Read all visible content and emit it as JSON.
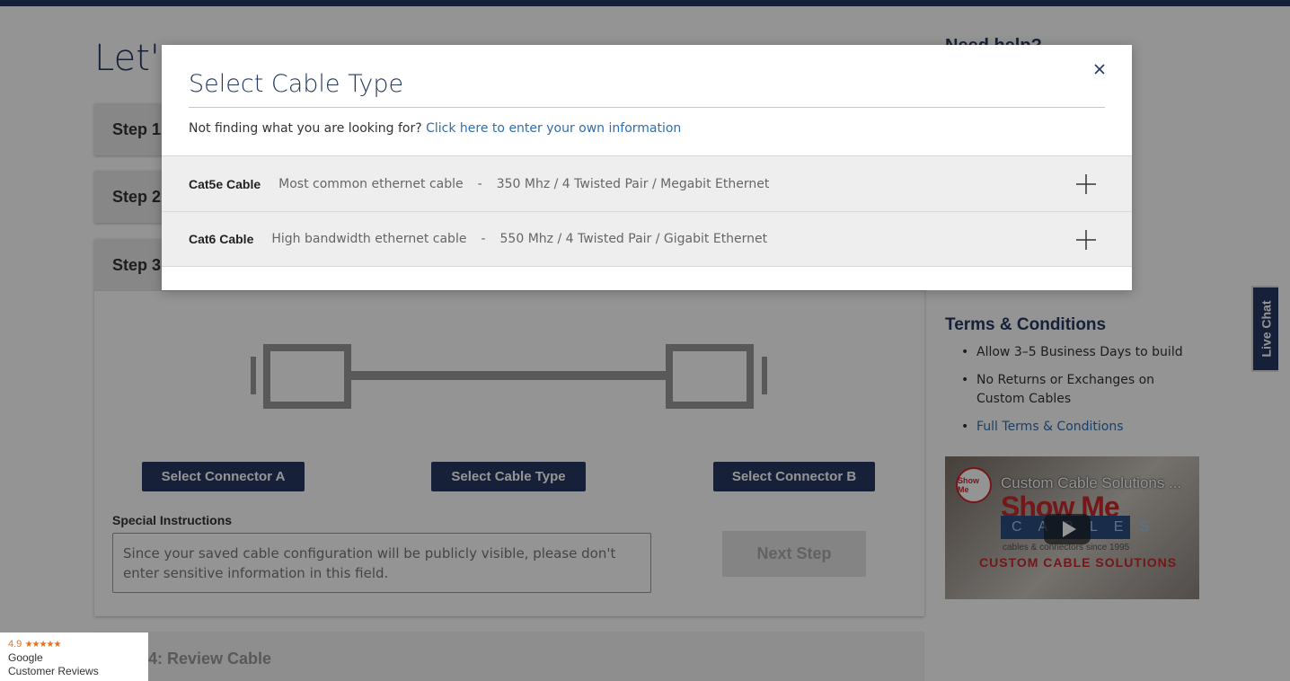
{
  "page": {
    "title_fragment": "Let's",
    "steps": [
      {
        "label": "Step 1:"
      },
      {
        "label": "Step 2:"
      },
      {
        "label": "Step 3:"
      },
      {
        "label": "4:   Review Cable"
      }
    ],
    "builder": {
      "connector_a_label": "Select Connector A",
      "cable_type_label": "Select Cable Type",
      "connector_b_label": "Select Connector B",
      "special_label": "Special Instructions",
      "special_placeholder": "Since your saved cable configuration will be publicly visible, please don't enter sensitive information in this field.",
      "next_label": "Next Step"
    }
  },
  "sidebar": {
    "help_title": "Need help?",
    "terms_title": "Terms & Conditions",
    "terms": [
      "Allow 3–5 Business Days to build",
      "No Returns or Exchanges on Custom Cables"
    ],
    "terms_link": "Full Terms & Conditions",
    "video": {
      "title": "Custom Cable Solutions ...",
      "logo": "Show Me",
      "brand_name": "Show Me",
      "brand_sub": "CABLES",
      "tagline": "cables & connectors since 1995",
      "banner": "CUSTOM CABLE SOLUTIONS"
    }
  },
  "live_chat": "Live Chat",
  "google_badge": {
    "rating": "4.9",
    "stars": "★★★★★",
    "line1": "Google",
    "line2": "Customer Reviews"
  },
  "modal": {
    "title": "Select Cable Type",
    "subtitle": "Not finding what you are looking for?",
    "link": "Click here to enter your own information",
    "options": [
      {
        "name": "Cat5e Cable",
        "desc": "Most common ethernet cable",
        "sep": "-",
        "spec": "350 Mhz / 4 Twisted Pair / Megabit Ethernet"
      },
      {
        "name": "Cat6 Cable",
        "desc": "High bandwidth ethernet cable",
        "sep": "-",
        "spec": "550 Mhz / 4 Twisted Pair / Gigabit Ethernet"
      }
    ]
  },
  "colors": {
    "navy": "#263a63",
    "link": "#2f6fb0",
    "brand_red": "#c7282c"
  }
}
